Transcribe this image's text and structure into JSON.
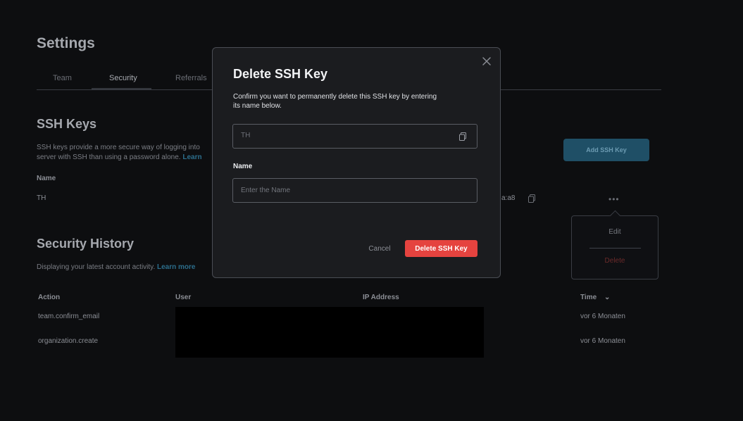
{
  "page": {
    "title": "Settings"
  },
  "tabs": [
    {
      "label": "Team"
    },
    {
      "label": "Security"
    },
    {
      "label": "Referrals"
    }
  ],
  "ssh": {
    "title": "SSH Keys",
    "desc_line1": "SSH keys provide a more secure way of logging into",
    "desc_line2": "server with SSH than using a password alone.",
    "desc_link": "Learn",
    "add_button": "Add SSH Key",
    "column_name": "Name",
    "key_name": "TH",
    "fingerprint_tail": "a:a8",
    "menu": {
      "edit": "Edit",
      "delete": "Delete"
    }
  },
  "history": {
    "title": "Security History",
    "desc": "Displaying your latest account activity.",
    "link": "Learn more",
    "columns": {
      "action": "Action",
      "user": "User",
      "ip": "IP Address",
      "time": "Time"
    },
    "rows": [
      {
        "action": "team.confirm_email",
        "time": "vor 6 Monaten"
      },
      {
        "action": "organization.create",
        "time": "vor 6 Monaten"
      }
    ]
  },
  "modal": {
    "title": "Delete SSH Key",
    "desc": "Confirm you want to permanently delete this SSH key by entering its name below.",
    "key_value": "TH",
    "name_label": "Name",
    "name_placeholder": "Enter the Name",
    "cancel": "Cancel",
    "confirm": "Delete SSH Key"
  },
  "colors": {
    "danger": "#e5433f",
    "accent": "#1f4f66"
  },
  "icons": [
    "close-icon",
    "copy-icon",
    "more-icon",
    "chevron-down-icon"
  ]
}
